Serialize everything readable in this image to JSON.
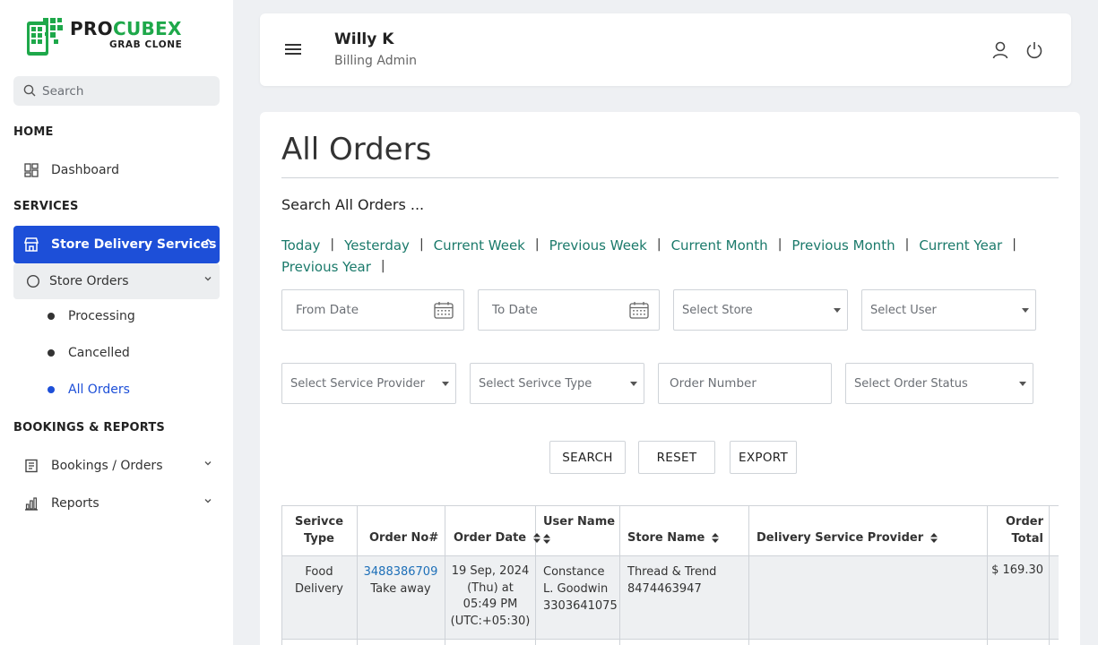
{
  "brand": {
    "name_part1": "PRO",
    "name_part2": "CUBEX",
    "subtitle": "GRAB CLONE",
    "accent_color": "#1ea84a"
  },
  "sidebar": {
    "search_placeholder": "Search",
    "home_heading": "HOME",
    "dashboard_label": "Dashboard",
    "services_heading": "SERVICES",
    "store_delivery_label": "Store Delivery Services",
    "store_orders_label": "Store Orders",
    "leaves": [
      "Processing",
      "Cancelled",
      "All Orders"
    ],
    "bookings_heading": "BOOKINGS & REPORTS",
    "bookings_label": "Bookings / Orders",
    "reports_label": "Reports",
    "active_color": "#1d4fd8"
  },
  "header": {
    "user_name": "Willy K",
    "user_role": "Billing Admin"
  },
  "main": {
    "title": "All Orders",
    "search_label": "Search All Orders ...",
    "quick_filters": [
      "Today",
      "Yesterday",
      "Current Week",
      "Previous Week",
      "Current Month",
      "Previous Month",
      "Current Year",
      "Previous Year"
    ],
    "filters": {
      "from_date": "From Date",
      "to_date": "To Date",
      "store": "Select Store",
      "user": "Select User",
      "service_provider": "Select Service Provider",
      "service_type": "Select Serivce Type",
      "order_number": "Order Number",
      "order_status": "Select Order Status"
    },
    "buttons": {
      "search": "SEARCH",
      "reset": "RESET",
      "export": "EXPORT"
    },
    "table": {
      "headers": [
        "Serivce Type",
        "Order No#",
        "Order Date",
        "User Name",
        "Store Name",
        "Delivery Service Provider",
        "Order Total"
      ],
      "rows": [
        {
          "service_type": "Food Delivery",
          "order_no": "3488386709",
          "order_kind": "Take away",
          "order_date": "19 Sep, 2024 (Thu) at 05:49 PM (UTC:+05:30)",
          "user_name": "Constance L. Goodwin",
          "user_phone": "3303641075",
          "store_name": "Thread & Trend",
          "store_phone": "8474463947",
          "provider": "",
          "total": "$ 169.30"
        }
      ]
    }
  }
}
